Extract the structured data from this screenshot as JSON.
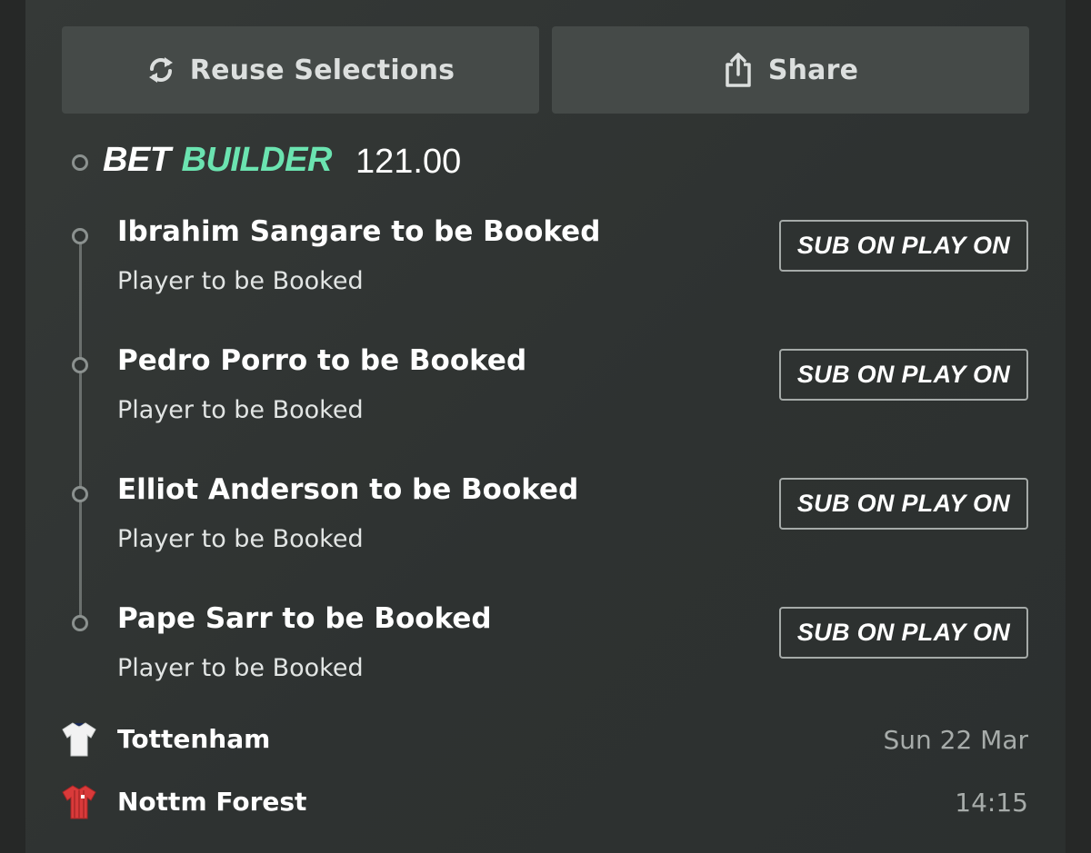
{
  "actions": {
    "reuse_label": "Reuse Selections",
    "share_label": "Share"
  },
  "bet": {
    "type_part1": "BET",
    "type_part2": "BUILDER",
    "odds": "121.00"
  },
  "selections": [
    {
      "title": "Ibrahim Sangare to be Booked",
      "market": "Player to be Booked",
      "badge": "SUB ON PLAY ON"
    },
    {
      "title": "Pedro Porro to be Booked",
      "market": "Player to be Booked",
      "badge": "SUB ON PLAY ON"
    },
    {
      "title": "Elliot Anderson to be Booked",
      "market": "Player to be Booked",
      "badge": "SUB ON PLAY ON"
    },
    {
      "title": "Pape Sarr to be Booked",
      "market": "Player to be Booked",
      "badge": "SUB ON PLAY ON"
    }
  ],
  "match": {
    "home_team": "Tottenham",
    "away_team": "Nottm Forest",
    "date": "Sun 22 Mar",
    "time": "14:15"
  },
  "colors": {
    "accent": "#6be3b0",
    "button_bg": "#454a48",
    "home_kit": "#f2f2f2",
    "away_kit": "#d93a3a"
  },
  "icons": {
    "reuse": "refresh-icon",
    "share": "share-icon",
    "home_kit": "shirt-icon",
    "away_kit": "shirt-icon"
  }
}
